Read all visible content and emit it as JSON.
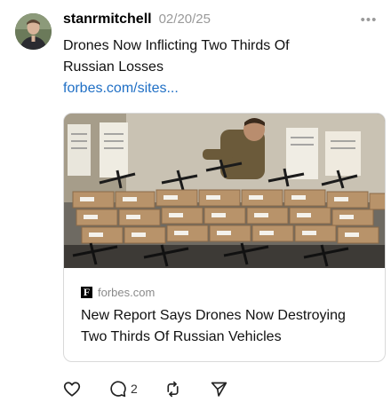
{
  "post": {
    "author": "stanrmitchell",
    "timestamp": "02/20/25",
    "text_line1": "Drones Now Inflicting Two Thirds Of",
    "text_line2": "Russian Losses",
    "link": "forbes.com/sites..."
  },
  "link_card": {
    "favicon_letter": "F",
    "domain": "forbes.com",
    "title_line1": "New Report Says Drones Now Destroying",
    "title_line2": "Two Thirds Of Russian Vehicles",
    "image_subject": "boxes-of-drones-photo"
  },
  "menu": {
    "more_icon": "more-horizontal-icon"
  },
  "actions": {
    "like_icon": "heart-icon",
    "reply_icon": "speech-bubble-icon",
    "reply_count": "2",
    "repost_icon": "repost-icon",
    "share_icon": "send-icon"
  },
  "colors": {
    "link": "#1f6fc5",
    "timestamp": "#999999",
    "border": "#d9d9d9"
  }
}
